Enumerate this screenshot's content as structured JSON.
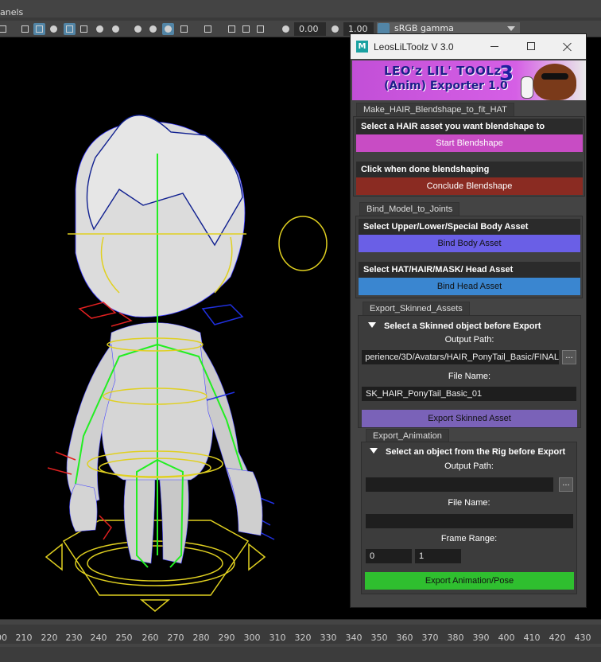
{
  "maya": {
    "menu_label": "anels",
    "toolbar": {
      "exposure_value": "0.00",
      "gamma_value": "1.00",
      "color_space": "sRGB gamma"
    },
    "timeline": {
      "ticks": [
        "00",
        "210",
        "220",
        "230",
        "240",
        "250",
        "260",
        "270",
        "280",
        "290",
        "300",
        "310",
        "320",
        "330",
        "340",
        "350",
        "360",
        "370",
        "380",
        "390",
        "400",
        "410",
        "420",
        "430"
      ]
    }
  },
  "tool": {
    "window_title": "LeosLiLToolz V 3.0",
    "icon_letter": "M",
    "banner": {
      "line1": "LEO'z LIL' TOOLz",
      "line2": "(Anim) Exporter 1.0",
      "number": "3"
    },
    "hair_section": {
      "tab": "Make_HAIR_Blendshape_to_fit_HAT",
      "prompt1": "Select a HAIR asset you want blendshape to",
      "start_button": "Start Blendshape",
      "prompt2": "Click when done blendshaping",
      "conclude_button": "Conclude Blendshape"
    },
    "bind_section": {
      "tab": "Bind_Model_to_Joints",
      "prompt_body": "Select Upper/Lower/Special Body Asset",
      "body_button": "Bind Body Asset",
      "prompt_head": "Select HAT/HAIR/MASK/ Head Asset",
      "head_button": "Bind Head Asset"
    },
    "export_skinned": {
      "tab": "Export_Skinned_Assets",
      "header": "Select a Skinned object before Export",
      "output_label": "Output Path:",
      "output_value": "perience/3D/Avatars/HAIR_PonyTail_Basic/FINAL",
      "browse": "...",
      "file_label": "File Name:",
      "file_value": "SK_HAIR_PonyTail_Basic_01",
      "button": "Export Skinned Asset"
    },
    "export_anim": {
      "tab": "Export_Animation",
      "header": "Select an object from the Rig before Export",
      "output_label": "Output Path:",
      "output_value": "",
      "browse": "...",
      "file_label": "File Name:",
      "file_value": "",
      "frame_label": "Frame Range:",
      "frame_start": "0",
      "frame_end": "1",
      "button": "Export Animation/Pose"
    },
    "colors": {
      "start_blendshape": "#c84cc4",
      "conclude_blendshape": "#8a2b22",
      "bind_body": "#6a5fe6",
      "bind_head": "#3a86d0",
      "export_skinned": "#7a62b8",
      "export_anim": "#2fbf2f"
    }
  }
}
